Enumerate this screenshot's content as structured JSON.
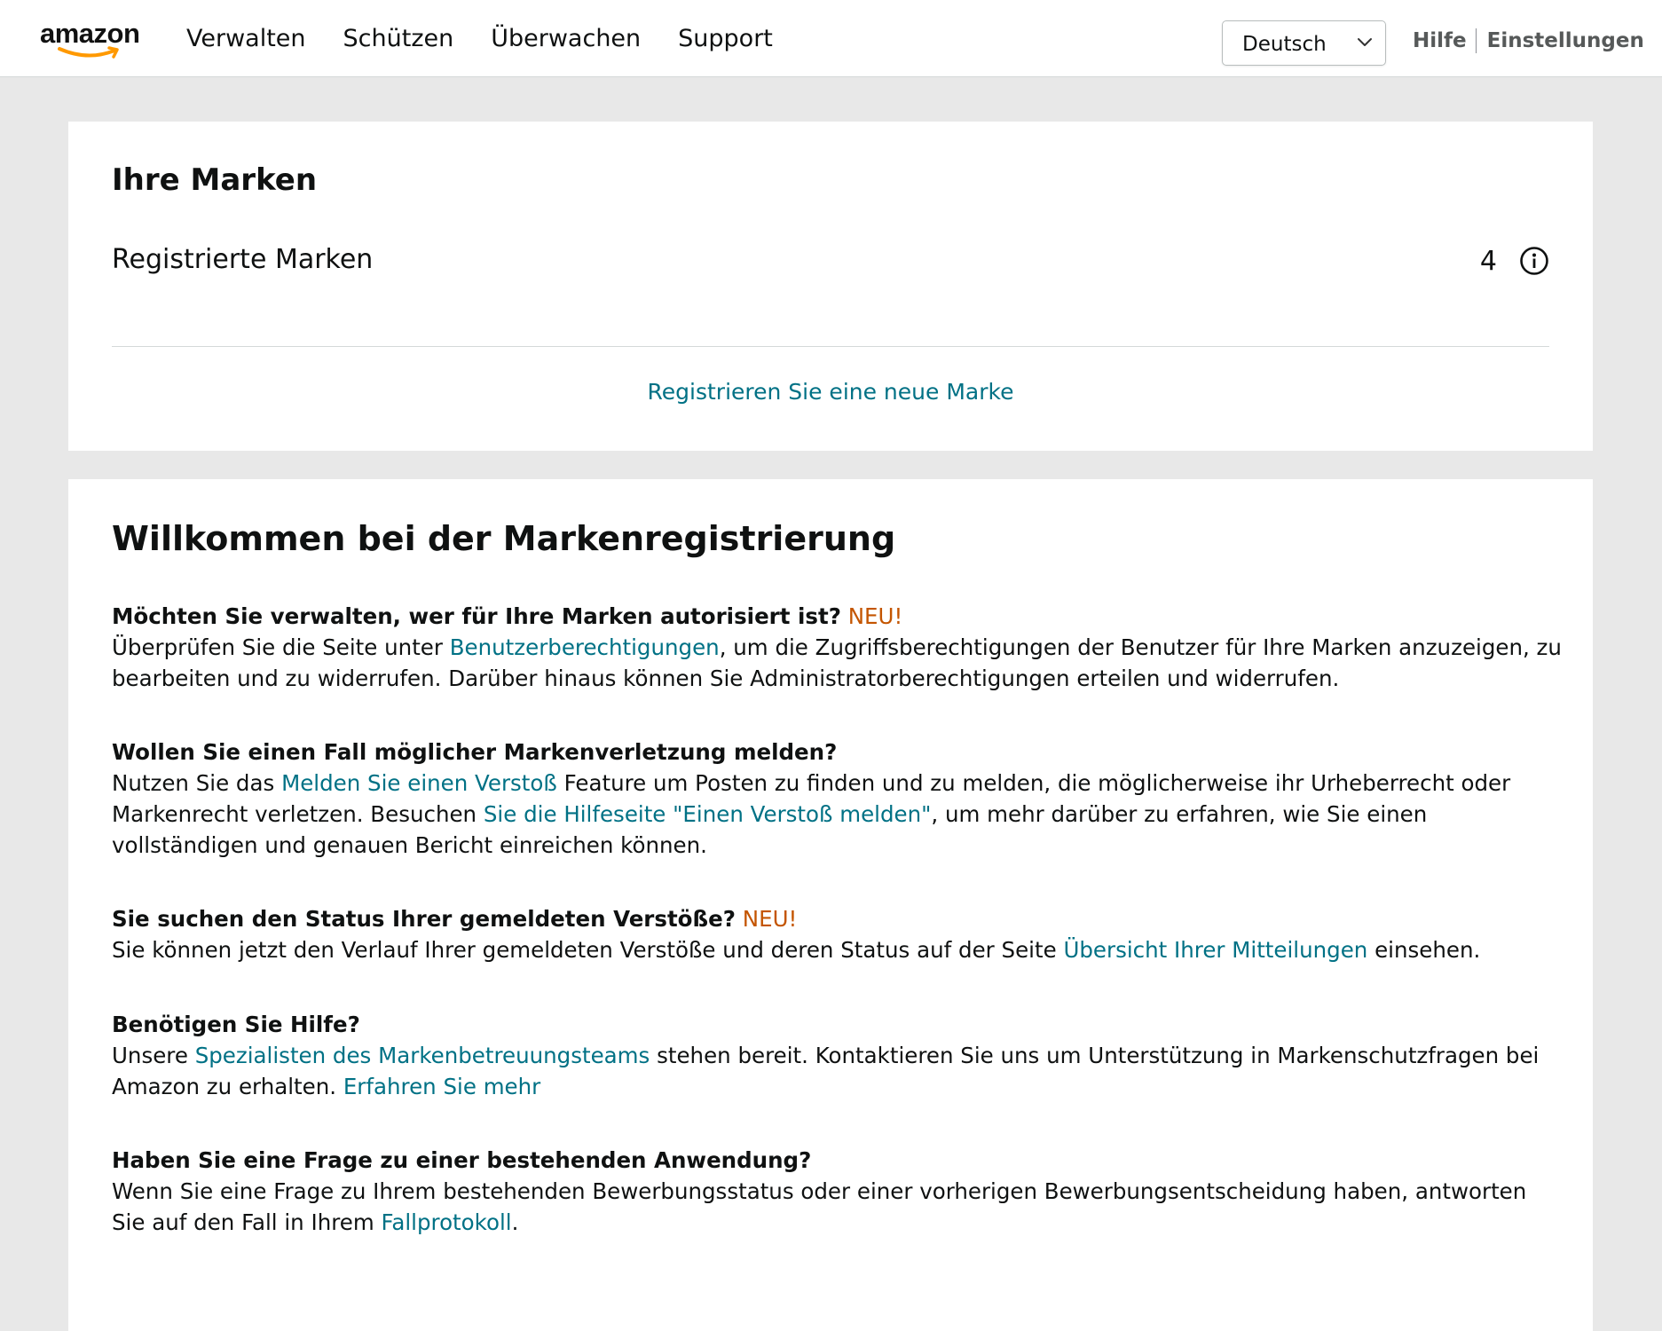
{
  "header": {
    "logo_text": "amazon",
    "nav": [
      "Verwalten",
      "Schützen",
      "Überwachen",
      "Support"
    ],
    "language": "Deutsch",
    "help": "Hilfe",
    "settings": "Einstellungen"
  },
  "brands": {
    "title": "Ihre Marken",
    "registered_label": "Registrierte Marken",
    "registered_count": "4",
    "register_new": "Registrieren Sie eine neue Marke"
  },
  "welcome": {
    "title": "Willkommen bei der Markenregistrierung",
    "new_badge": "NEU!",
    "s1": {
      "q": "Möchten Sie verwalten, wer für Ihre Marken autorisiert ist?",
      "t1": "Überprüfen Sie die Seite unter ",
      "link1": "Benutzerberechtigungen",
      "t2": ", um die Zugriffsberechtigungen der Benutzer für Ihre Marken anzuzeigen, zu bearbeiten und zu widerrufen. Darüber hinaus können Sie Administratorberechtigungen erteilen und widerrufen."
    },
    "s2": {
      "q": "Wollen Sie einen Fall möglicher Markenverletzung melden?",
      "t1": "Nutzen Sie das ",
      "link1": "Melden Sie einen Verstoß",
      "t2": " Feature um Posten zu finden und zu melden, die möglicherweise ihr Urheberrecht oder Markenrecht verletzen. Besuchen ",
      "link2": "Sie die Hilfeseite \"Einen Verstoß melden\"",
      "t3": ", um mehr darüber zu erfahren, wie Sie einen vollständigen und genauen Bericht einreichen können."
    },
    "s3": {
      "q": "Sie suchen den Status Ihrer gemeldeten Verstöße?",
      "t1": "Sie können jetzt den Verlauf Ihrer gemeldeten Verstöße und deren Status auf der Seite ",
      "link1": "Übersicht Ihrer Mitteilungen",
      "t2": " einsehen."
    },
    "s4": {
      "q": "Benötigen Sie Hilfe?",
      "t1": "Unsere ",
      "link1": "Spezialisten des Markenbetreuungsteams",
      "t2": " stehen bereit. Kontaktieren Sie uns um Unterstützung in Markenschutzfragen bei Amazon zu erhalten. ",
      "link2": "Erfahren Sie mehr"
    },
    "s5": {
      "q": "Haben Sie eine Frage zu einer bestehenden Anwendung?",
      "t1": "Wenn Sie eine Frage zu Ihrem bestehenden Bewerbungsstatus oder einer vorherigen Bewerbungsentscheidung haben, antworten Sie auf den Fall in Ihrem ",
      "link1": "Fallprotokoll",
      "t2": "."
    }
  },
  "colors": {
    "link": "#007185",
    "new_badge": "#c45500",
    "logo_smile": "#ff9900",
    "background": "#e8e8e8"
  },
  "icons": [
    "amazon-smile-icon",
    "chevron-down-icon",
    "info-icon"
  ]
}
